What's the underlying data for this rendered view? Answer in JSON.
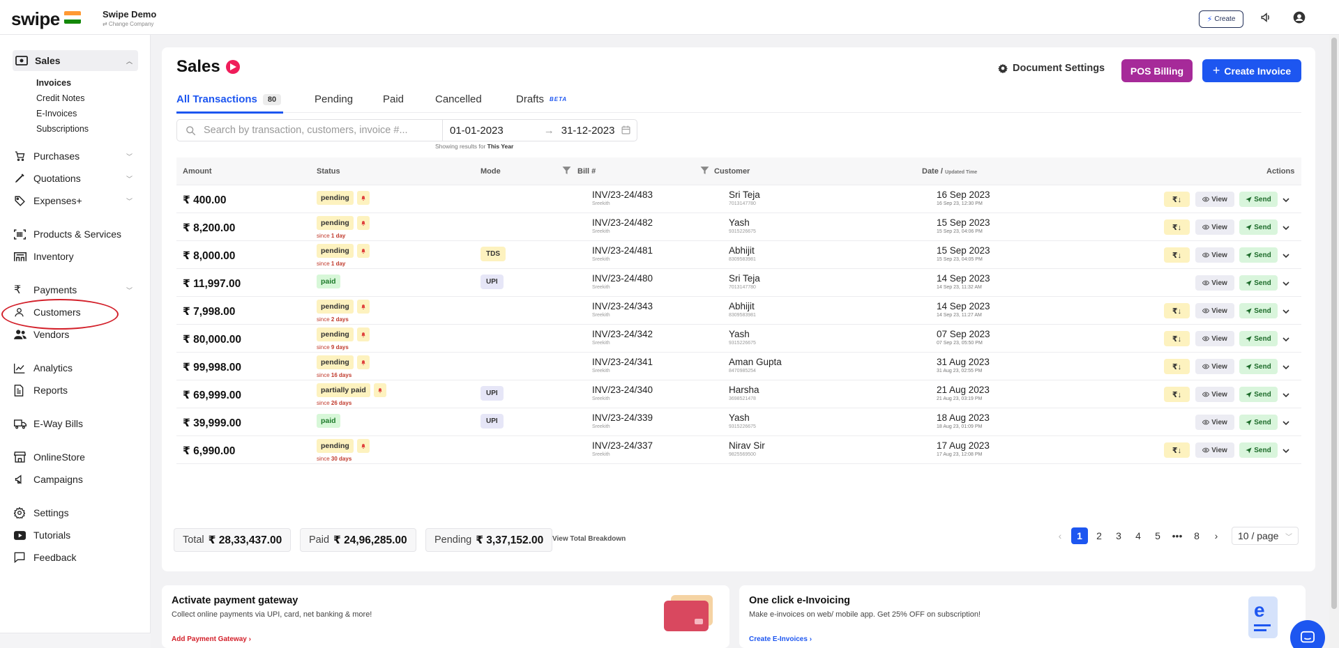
{
  "header": {
    "logo": "swipe",
    "company_name": "Swipe Demo",
    "change_company": "⇄ Change Company",
    "create_label": "Create"
  },
  "sidebar": {
    "sales": "Sales",
    "sales_sub": [
      "Invoices",
      "Credit Notes",
      "E-Invoices",
      "Subscriptions"
    ],
    "items": [
      {
        "label": "Purchases",
        "icon": "cart-icon",
        "chevron": true
      },
      {
        "label": "Quotations",
        "icon": "pen-icon",
        "chevron": true
      },
      {
        "label": "Expenses+",
        "icon": "tag-icon",
        "chevron": true
      },
      {
        "label": "Products & Services",
        "icon": "barcode-icon",
        "chevron": false
      },
      {
        "label": "Inventory",
        "icon": "warehouse-icon",
        "chevron": false
      },
      {
        "label": "Payments",
        "icon": "rupee-icon",
        "chevron": true
      },
      {
        "label": "Customers",
        "icon": "user-icon",
        "chevron": false
      },
      {
        "label": "Vendors",
        "icon": "users-icon",
        "chevron": false
      },
      {
        "label": "Analytics",
        "icon": "chart-icon",
        "chevron": false
      },
      {
        "label": "Reports",
        "icon": "report-icon",
        "chevron": false
      },
      {
        "label": "E-Way Bills",
        "icon": "truck-icon",
        "chevron": false
      },
      {
        "label": "OnlineStore",
        "icon": "store-icon",
        "chevron": false
      },
      {
        "label": "Campaigns",
        "icon": "megaphone-icon",
        "chevron": false
      },
      {
        "label": "Settings",
        "icon": "gear-icon",
        "chevron": false
      },
      {
        "label": "Tutorials",
        "icon": "youtube-icon",
        "chevron": false
      },
      {
        "label": "Feedback",
        "icon": "message-icon",
        "chevron": false
      }
    ]
  },
  "page": {
    "title": "Sales",
    "document_settings": "Document Settings",
    "pos_billing": "POS Billing",
    "create_invoice": "Create Invoice"
  },
  "tabs": [
    {
      "label": "All Transactions",
      "count": "80"
    },
    {
      "label": "Pending"
    },
    {
      "label": "Paid"
    },
    {
      "label": "Cancelled"
    },
    {
      "label": "Drafts",
      "badge": "BETA"
    }
  ],
  "search": {
    "placeholder": "Search by transaction, customers, invoice #...",
    "date_from": "01-01-2023",
    "date_to": "31-12-2023",
    "showing_prefix": "Showing results for ",
    "showing_period": "This Year"
  },
  "table": {
    "headers": {
      "amount": "Amount",
      "status": "Status",
      "mode": "Mode",
      "bill": "Bill #",
      "customer": "Customer",
      "date": "Date /",
      "date_sub": "Updated Time",
      "actions": "Actions"
    },
    "view_label": "View",
    "send_label": "Send",
    "rupee_action": "₹↓",
    "rows": [
      {
        "amount": "₹ 400.00",
        "status": "pending",
        "status_type": "pending",
        "since": "",
        "mode": "",
        "bill": "INV/23-24/483",
        "by": "Sreekith",
        "customer": "Sri Teja",
        "phone": "7013147780",
        "date": "16 Sep 2023",
        "time": "16 Sep 23, 12:30 PM",
        "has_rupee": true
      },
      {
        "amount": "₹ 8,200.00",
        "status": "pending",
        "status_type": "pending",
        "since": "1 day",
        "mode": "",
        "bill": "INV/23-24/482",
        "by": "Sreekith",
        "customer": "Yash",
        "phone": "9315226675",
        "date": "15 Sep 2023",
        "time": "15 Sep 23, 04:06 PM",
        "has_rupee": true
      },
      {
        "amount": "₹ 8,000.00",
        "status": "pending",
        "status_type": "pending",
        "since": "1 day",
        "mode": "TDS",
        "mode_type": "tds",
        "bill": "INV/23-24/481",
        "by": "Sreekith",
        "customer": "Abhijit",
        "phone": "8309583981",
        "date": "15 Sep 2023",
        "time": "15 Sep 23, 04:05 PM",
        "has_rupee": true
      },
      {
        "amount": "₹ 11,997.00",
        "status": "paid",
        "status_type": "paid",
        "since": "",
        "mode": "UPI",
        "mode_type": "upi",
        "bill": "INV/23-24/480",
        "by": "Sreekith",
        "customer": "Sri Teja",
        "phone": "7013147780",
        "date": "14 Sep 2023",
        "time": "14 Sep 23, 11:32 AM",
        "has_rupee": false
      },
      {
        "amount": "₹ 7,998.00",
        "status": "pending",
        "status_type": "pending",
        "since": "2 days",
        "mode": "",
        "bill": "INV/23-24/343",
        "by": "Sreekith",
        "customer": "Abhijit",
        "phone": "8309583981",
        "date": "14 Sep 2023",
        "time": "14 Sep 23, 11:27 AM",
        "has_rupee": true
      },
      {
        "amount": "₹ 80,000.00",
        "status": "pending",
        "status_type": "pending",
        "since": "9 days",
        "mode": "",
        "bill": "INV/23-24/342",
        "by": "Sreekith",
        "customer": "Yash",
        "phone": "9315226675",
        "date": "07 Sep 2023",
        "time": "07 Sep 23, 05:50 PM",
        "has_rupee": true
      },
      {
        "amount": "₹ 99,998.00",
        "status": "pending",
        "status_type": "pending",
        "since": "16 days",
        "mode": "",
        "bill": "INV/23-24/341",
        "by": "Sreekith",
        "customer": "Aman Gupta",
        "phone": "8470985254",
        "date": "31 Aug 2023",
        "time": "31 Aug 23, 02:55 PM",
        "has_rupee": true
      },
      {
        "amount": "₹ 69,999.00",
        "status": "partially paid",
        "status_type": "partial",
        "since": "26 days",
        "mode": "UPI",
        "mode_type": "upi",
        "bill": "INV/23-24/340",
        "by": "Sreekith",
        "customer": "Harsha",
        "phone": "3698521478",
        "date": "21 Aug 2023",
        "time": "21 Aug 23, 03:19 PM",
        "has_rupee": true
      },
      {
        "amount": "₹ 39,999.00",
        "status": "paid",
        "status_type": "paid",
        "since": "",
        "mode": "UPI",
        "mode_type": "upi",
        "bill": "INV/23-24/339",
        "by": "Sreekith",
        "customer": "Yash",
        "phone": "9315226675",
        "date": "18 Aug 2023",
        "time": "18 Aug 23, 01:09 PM",
        "has_rupee": false
      },
      {
        "amount": "₹ 6,990.00",
        "status": "pending",
        "status_type": "pending",
        "since": "30 days",
        "mode": "",
        "bill": "INV/23-24/337",
        "by": "Sreekith",
        "customer": "Nirav Sir",
        "phone": "9825569500",
        "date": "17 Aug 2023",
        "time": "17 Aug 23, 12:08 PM",
        "has_rupee": true
      }
    ],
    "since_prefix": "since "
  },
  "totals": {
    "total_label": "Total",
    "total_value": "₹ 28,33,437.00",
    "paid_label": "Paid",
    "paid_value": "₹ 24,96,285.00",
    "pending_label": "Pending",
    "pending_value": "₹ 3,37,152.00",
    "breakdown": "View Total Breakdown"
  },
  "pagination": {
    "pages": [
      "1",
      "2",
      "3",
      "4",
      "5",
      "•••",
      "8"
    ],
    "current": "1",
    "per_page": "10 / page"
  },
  "promos": [
    {
      "title": "Activate payment gateway",
      "desc": "Collect online payments via UPI, card, net banking & more!",
      "link": "Add Payment Gateway",
      "color": "#d3202a"
    },
    {
      "title": "One click e-Invoicing",
      "desc": "Make e-invoices on web/ mobile app. Get 25% OFF on subscription!",
      "link": "Create E-Invoices",
      "color": "#1d56f0"
    }
  ],
  "colors": {
    "accent": "#1d56f0",
    "pos": "#a62a99",
    "pending_bg": "#fdf2bf",
    "paid_bg": "#d7f7d8"
  }
}
